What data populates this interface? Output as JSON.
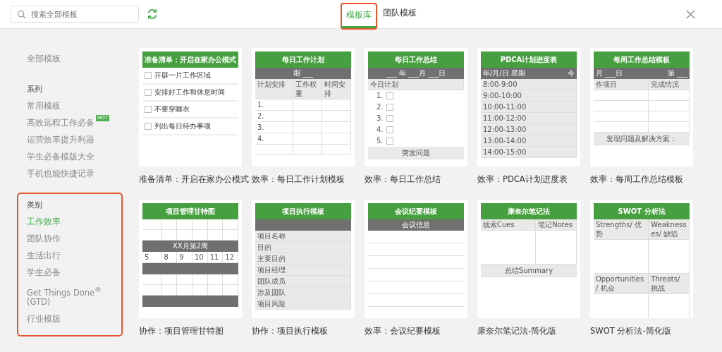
{
  "search": {
    "placeholder": "搜索全部模板"
  },
  "tabs": [
    {
      "label": "模板库",
      "selected": true,
      "highlighted": true
    },
    {
      "label": "团队模板",
      "selected": false,
      "highlighted": false
    }
  ],
  "sidebar": {
    "all": {
      "label": "全部模板",
      "selected": false
    },
    "sections": [
      {
        "title": "系列",
        "highlighted": false,
        "items": [
          {
            "label": "常用模板",
            "selected": false
          },
          {
            "label": "高效远程工作必备",
            "selected": false,
            "badge": "HOT"
          },
          {
            "label": "运营效率提升利器",
            "selected": false
          },
          {
            "label": "学生必备模版大全",
            "selected": false
          },
          {
            "label": "手机也能快捷记录",
            "selected": false
          }
        ]
      },
      {
        "title": "类别",
        "highlighted": true,
        "items": [
          {
            "label": "工作效率",
            "selected": true
          },
          {
            "label": "团队协作",
            "selected": false
          },
          {
            "label": "生活出行",
            "selected": false
          },
          {
            "label": "学生必备",
            "selected": false
          },
          {
            "label": "Get Things Done$^{®}$ (GTD)",
            "selected": false
          },
          {
            "label": "行业模版",
            "selected": false
          }
        ]
      }
    ]
  },
  "templates": [
    {
      "title": "准备清单：开启在家办公模式",
      "caption": "准备清单：开启在家办公模式",
      "rows": [
        {
          "kind": "task",
          "cells": [
            "开辟一片工作区域"
          ]
        },
        {
          "kind": "task",
          "cells": [
            "安排好工作和休息时间"
          ]
        },
        {
          "kind": "task",
          "cells": [
            "不要穿睡衣"
          ]
        },
        {
          "kind": "task",
          "cells": [
            "列出每日待办事项"
          ]
        }
      ]
    },
    {
      "title": "每日工作计划",
      "caption": "效率：每日工作计划模板",
      "rows": [
        {
          "kind": "dark",
          "cells": [
            "期 ___"
          ]
        },
        {
          "kind": "head",
          "cells": [
            "计划安排",
            "工作权重",
            "时间安排"
          ]
        },
        {
          "kind": "body",
          "cells": [
            "1."
          ]
        },
        {
          "kind": "body",
          "cells": [
            "2."
          ]
        },
        {
          "kind": "body",
          "cells": [
            "3."
          ]
        },
        {
          "kind": "body",
          "cells": [
            "4."
          ]
        },
        {
          "kind": "body"
        }
      ]
    },
    {
      "title": "每日工作总结",
      "caption": "效率：每日工作总结",
      "rows": [
        {
          "kind": "dark",
          "cells": [
            "___ 年 ___月 ___日"
          ]
        },
        {
          "kind": "head",
          "cells": [
            "今日计划"
          ]
        },
        {
          "kind": "check",
          "cells": [
            "1."
          ]
        },
        {
          "kind": "check",
          "cells": [
            "2."
          ]
        },
        {
          "kind": "check",
          "cells": [
            "3."
          ]
        },
        {
          "kind": "check",
          "cells": [
            "4."
          ]
        },
        {
          "kind": "check",
          "cells": [
            "5."
          ]
        },
        {
          "kind": "wide",
          "cells": [
            "突发问题"
          ]
        }
      ]
    },
    {
      "title": "PDCA计划进度表",
      "caption": "效率：PDCA计划进度表",
      "rows": [
        {
          "kind": "dark",
          "cells": [
            "年/月/日 星期",
            "今"
          ]
        },
        {
          "kind": "label",
          "cells": [
            "8:00-9:00"
          ]
        },
        {
          "kind": "label",
          "cells": [
            "9:00-10:00"
          ]
        },
        {
          "kind": "label",
          "cells": [
            "10:00-11:00"
          ]
        },
        {
          "kind": "label",
          "cells": [
            "11:00-12:00"
          ]
        },
        {
          "kind": "label",
          "cells": [
            "12:00-13:00"
          ]
        },
        {
          "kind": "label",
          "cells": [
            "13:00-14:00"
          ]
        },
        {
          "kind": "label",
          "cells": [
            "14:00-15:00"
          ]
        }
      ]
    },
    {
      "title": "每周工作总结模板",
      "caption": "效率：每周工作总结模板",
      "rows": [
        {
          "kind": "dark",
          "cells": [
            "月 ___日",
            "第 ___"
          ]
        },
        {
          "kind": "head",
          "cells": [
            "作项目",
            "完成情况"
          ]
        },
        {
          "kind": "body"
        },
        {
          "kind": "body"
        },
        {
          "kind": "body"
        },
        {
          "kind": "body"
        },
        {
          "kind": "wide",
          "cells": [
            "发现问题及解决方案："
          ]
        }
      ]
    },
    {
      "title": "项目管理甘特图",
      "caption": "协作：项目管理甘特图",
      "rows": [
        {
          "kind": "body"
        },
        {
          "kind": "body"
        },
        {
          "kind": "dark",
          "cells": [
            "XX月第2周"
          ]
        },
        {
          "kind": "body",
          "cells": [
            "5",
            "8",
            "9",
            "10",
            "11",
            "12"
          ]
        },
        {
          "kind": "dark"
        },
        {
          "kind": "body"
        },
        {
          "kind": "body"
        },
        {
          "kind": "dark"
        }
      ]
    },
    {
      "title": "项目执行模板",
      "caption": "协作：项目执行模板",
      "rows": [
        {
          "kind": "dark"
        },
        {
          "kind": "label",
          "cells": [
            "项目名称"
          ]
        },
        {
          "kind": "label",
          "cells": [
            "目的"
          ]
        },
        {
          "kind": "label",
          "cells": [
            "主要目的"
          ]
        },
        {
          "kind": "label",
          "cells": [
            "项目经理"
          ]
        },
        {
          "kind": "label",
          "cells": [
            "团队成员"
          ]
        },
        {
          "kind": "label",
          "cells": [
            "涉及团队"
          ]
        },
        {
          "kind": "label",
          "cells": [
            "项目风险"
          ]
        }
      ]
    },
    {
      "title": "会议纪要模板",
      "caption": "效率：会议纪要模板",
      "rows": [
        {
          "kind": "dark",
          "cells": [
            "会议信息"
          ]
        },
        {
          "kind": "wide"
        },
        {
          "kind": "wide"
        },
        {
          "kind": "wide"
        },
        {
          "kind": "wide"
        },
        {
          "kind": "wide"
        },
        {
          "kind": "wide"
        },
        {
          "kind": "wide"
        }
      ]
    },
    {
      "title": "康奈尔笔记法",
      "caption": "康奈尔笔记法-简化版",
      "rows": [
        {
          "kind": "head",
          "cells": [
            "线索Cues",
            "笔记Notes"
          ]
        },
        {
          "kind": "tall"
        },
        {
          "kind": "wide",
          "cells": [
            "总结Summary"
          ]
        }
      ]
    },
    {
      "title": "SWOT 分析法",
      "caption": "SWOT 分析法-简化版",
      "rows": [
        {
          "kind": "head",
          "cells": [
            "Strengths/ 优势",
            "Weaknesses/ 缺陷"
          ]
        },
        {
          "kind": "tall"
        },
        {
          "kind": "head",
          "cells": [
            "Opportunities/ 机会",
            "Threats/ 挑战"
          ]
        },
        {
          "kind": "tall"
        }
      ]
    }
  ]
}
